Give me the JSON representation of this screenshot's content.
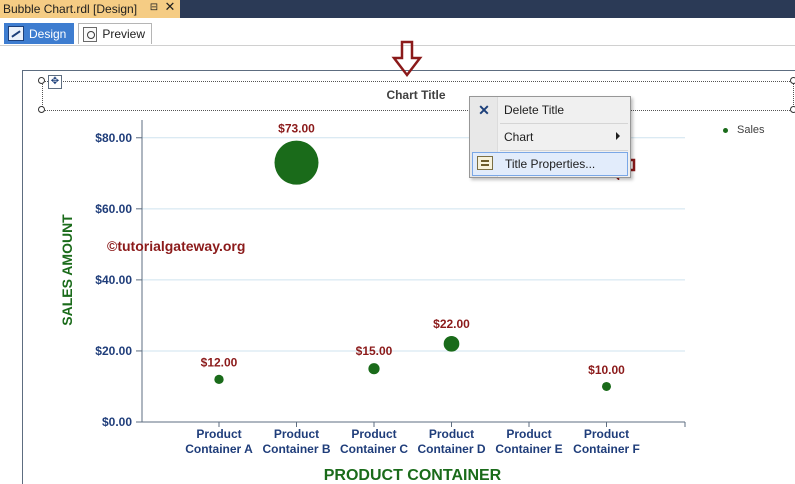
{
  "document_tab": {
    "title": "Bubble Chart.rdl [Design]"
  },
  "view_tabs": [
    {
      "label": "Design",
      "active": true
    },
    {
      "label": "Preview",
      "active": false
    }
  ],
  "chart": {
    "title": "Chart Title"
  },
  "watermark": "©tutorialgateway.org",
  "context_menu": {
    "items": [
      {
        "label": "Delete Title",
        "icon": "close-icon"
      },
      {
        "label": "Chart",
        "icon": "none",
        "has_submenu": true
      },
      {
        "label": "Title Properties...",
        "icon": "properties-icon",
        "highlighted": true
      }
    ]
  },
  "chart_data": {
    "type": "scatter",
    "title": "Chart Title",
    "xlabel": "PRODUCT CONTAINER",
    "ylabel": "SALES AMOUNT",
    "categories": [
      "Product Container A",
      "Product Container B",
      "Product Container C",
      "Product Container D",
      "Product Container E",
      "Product Container F"
    ],
    "y_tick_labels": [
      "$0.00",
      "$20.00",
      "$40.00",
      "$60.00",
      "$80.00"
    ],
    "ylim": [
      0,
      85
    ],
    "grid": true,
    "legend": {
      "position": "top-right",
      "entries": [
        "Sales"
      ]
    },
    "series": [
      {
        "name": "Sales",
        "color": "#1a6b1a",
        "points": [
          {
            "category": "Product Container A",
            "value": 12,
            "label": "$12.00"
          },
          {
            "category": "Product Container B",
            "value": 73,
            "label": "$73.00"
          },
          {
            "category": "Product Container C",
            "value": 15,
            "label": "$15.00"
          },
          {
            "category": "Product Container D",
            "value": 22,
            "label": "$22.00"
          },
          {
            "category": "Product Container F",
            "value": 10,
            "label": "$10.00"
          }
        ]
      }
    ],
    "label_color": "#8b1a1a",
    "axis_text_color": "#1f3d7a",
    "axis_title_color": "#1a6b1a",
    "callout_color": "#8b1a1a"
  }
}
